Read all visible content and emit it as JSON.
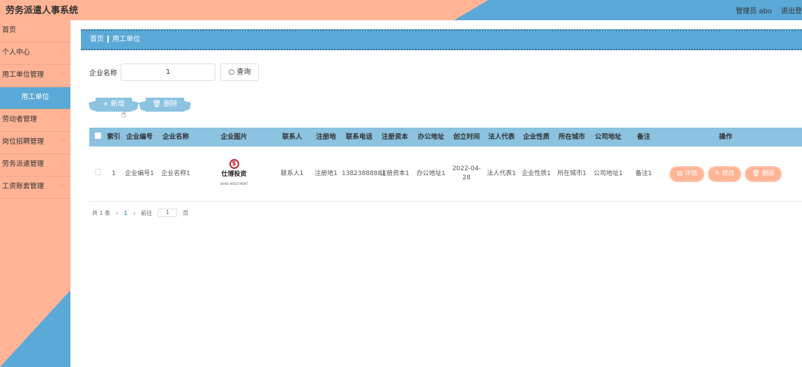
{
  "app": {
    "title": "劳务派遣人事系统",
    "user_label": "管理员 abo",
    "logout": "退出登"
  },
  "sidebar": {
    "items": [
      {
        "label": "首页",
        "chevron": false,
        "sub": false
      },
      {
        "label": "个人中心",
        "chevron": true,
        "sub": false
      },
      {
        "label": "用工单位管理",
        "chevron": true,
        "sub": false
      },
      {
        "label": "用工单位",
        "chevron": false,
        "sub": true
      },
      {
        "label": "劳动者管理",
        "chevron": true,
        "sub": false
      },
      {
        "label": "岗位招聘管理",
        "chevron": true,
        "sub": false
      },
      {
        "label": "劳务派遣管理",
        "chevron": true,
        "sub": false
      },
      {
        "label": "工资账套管理",
        "chevron": true,
        "sub": false
      }
    ]
  },
  "breadcrumb": {
    "home": "首页",
    "current": "用工单位"
  },
  "search": {
    "label": "企业名称",
    "value": "1",
    "button": "查询"
  },
  "toolbar": {
    "add": "新增",
    "delete": "删除"
  },
  "table": {
    "headers": [
      "索引",
      "企业编号",
      "企业名称",
      "企业图片",
      "联系人",
      "注册地",
      "联系电话",
      "注册资本",
      "办公地址",
      "创立时间",
      "法人代表",
      "企业性质",
      "所在城市",
      "公司地址",
      "备注",
      "操作"
    ],
    "rows": [
      {
        "index": "1",
        "code": "企业编号1",
        "name": "企业名称1",
        "logo_text": "仕博投资",
        "logo_sub": "SHIBO INVESTMENT",
        "contact": "联系人1",
        "reg_place": "注册地1",
        "phone": "13823888881",
        "capital": "注册资本1",
        "office": "办公地址1",
        "founded": "2022-04-28",
        "legal": "法人代表1",
        "nature": "企业性质1",
        "city": "所在城市1",
        "address": "公司地址1",
        "remark": "备注1"
      }
    ],
    "actions": {
      "detail": "详情",
      "edit": "修改",
      "delete": "删除"
    }
  },
  "pager": {
    "total": "共 1 条",
    "prev": "‹",
    "page": "1",
    "next": "›",
    "goto_label": "前往",
    "goto_value": "1",
    "page_unit": "页"
  },
  "colors": {
    "accent_blue": "#5aa9d6",
    "peach": "#ffb496",
    "header_blue": "#8bc3e0"
  }
}
